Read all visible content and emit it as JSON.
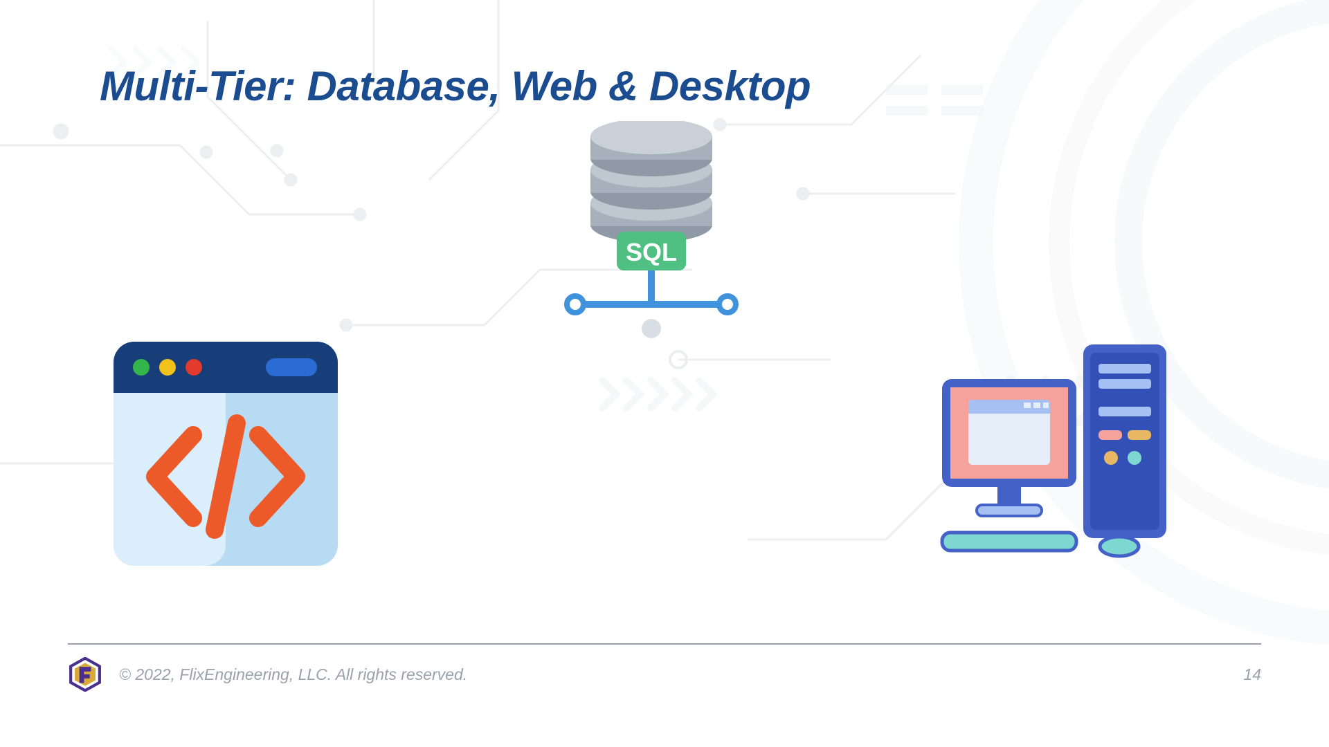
{
  "title": "Multi-Tier: Database, Web & Desktop",
  "database": {
    "label": "SQL"
  },
  "footer": {
    "copyright": "© 2022, FlixEngineering, LLC. All rights reserved.",
    "page_number": "14"
  }
}
